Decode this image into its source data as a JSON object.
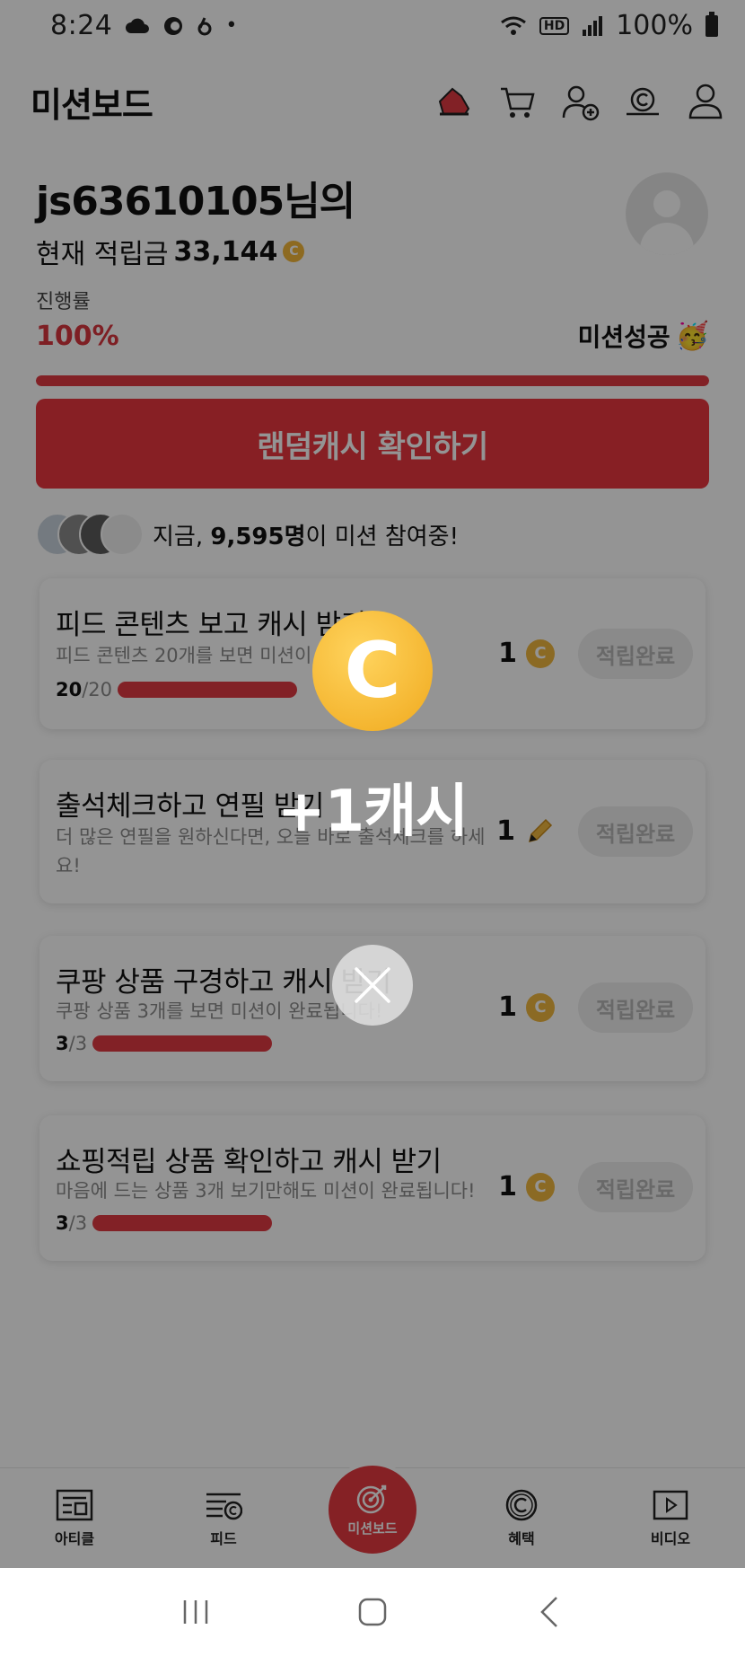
{
  "status_bar": {
    "time": "8:24",
    "network_badge": "HD",
    "battery": "100%"
  },
  "header": {
    "title": "미션보드",
    "icons": [
      "shoe-icon",
      "cart-icon",
      "add-friend-icon",
      "cash-hand-icon",
      "profile-icon"
    ]
  },
  "user": {
    "name": "js63610105님의",
    "cash_label": "현재 적립금",
    "cash_amount": "33,144",
    "coin_symbol": "C"
  },
  "progress": {
    "label": "진행률",
    "value": "100%",
    "fraction": 1.0,
    "status": "미션성공"
  },
  "random_cash_button": "랜덤캐시 확인하기",
  "participants": {
    "prefix": "지금,",
    "count": "9,595명",
    "suffix": "이 미션 참여중!"
  },
  "missions": [
    {
      "title": "피드 콘텐츠 보고 캐시 받기",
      "desc": "피드 콘텐츠 20개를 보면 미션이 완료됩니다!",
      "done": "20",
      "total": "/20",
      "reward": "1",
      "reward_icon": "coin-icon",
      "button": "적립완료"
    },
    {
      "title": "출석체크하고 연필 받기",
      "desc": "더 많은 연필을 원하신다면, 오늘 바로 출석체크를 하세요!",
      "reward": "1",
      "reward_icon": "pencil-icon",
      "button": "적립완료"
    },
    {
      "title": "쿠팡 상품 구경하고 캐시 받기",
      "desc": "쿠팡 상품 3개를 보면 미션이 완료됩니다!",
      "done": "3",
      "total": "/3",
      "reward": "1",
      "reward_icon": "coin-icon",
      "button": "적립완료"
    },
    {
      "title": "쇼핑적립 상품 확인하고 캐시 받기",
      "desc": "마음에 드는 상품 3개 보기만해도 미션이 완료됩니다!",
      "done": "3",
      "total": "/3",
      "reward": "1",
      "reward_icon": "coin-icon",
      "button": "적립완료"
    }
  ],
  "bottom_nav": {
    "items": [
      {
        "label": "아티클",
        "icon": "article-icon"
      },
      {
        "label": "피드",
        "icon": "feed-icon"
      },
      {
        "label": "미션보드",
        "icon": "target-icon"
      },
      {
        "label": "혜택",
        "icon": "benefit-coin-icon"
      },
      {
        "label": "비디오",
        "icon": "video-icon"
      }
    ]
  },
  "popup": {
    "coin_letter": "C",
    "text": "+1캐시"
  },
  "colors": {
    "accent": "#e9363f",
    "coin": "#f0b73e",
    "done_button_bg": "#eeeeee"
  }
}
